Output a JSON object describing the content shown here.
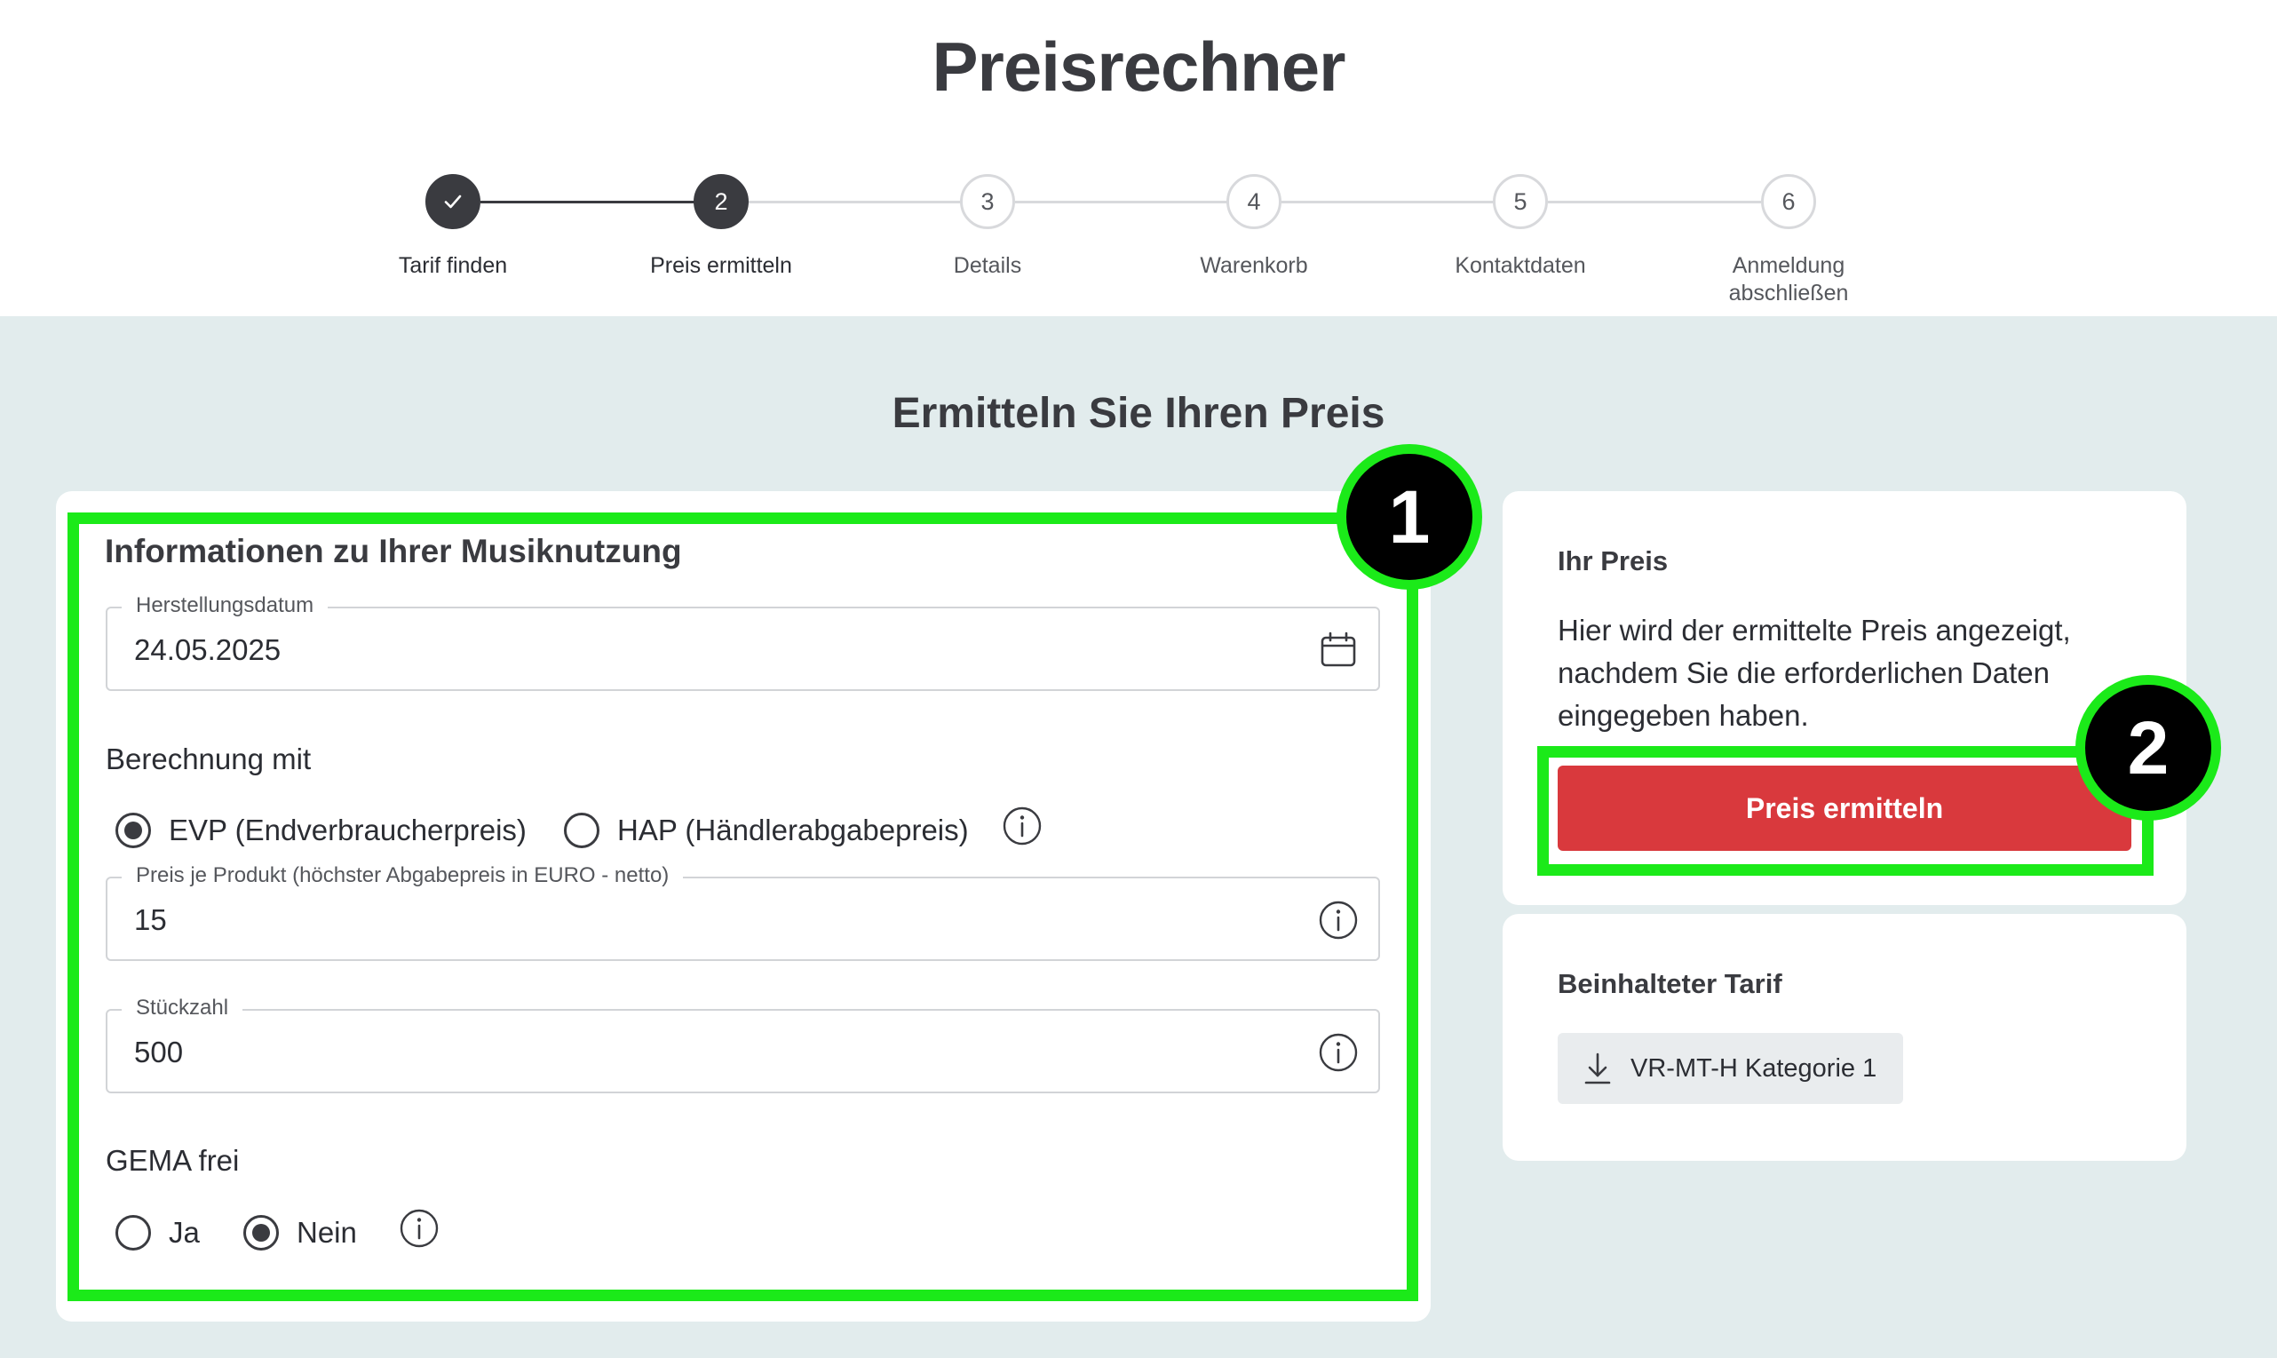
{
  "page_title": "Preisrechner",
  "stepper": {
    "steps": [
      {
        "number": "",
        "label": "Tarif finden",
        "state": "done"
      },
      {
        "number": "2",
        "label": "Preis ermitteln",
        "state": "active"
      },
      {
        "number": "3",
        "label": "Details",
        "state": "upcoming"
      },
      {
        "number": "4",
        "label": "Warenkorb",
        "state": "upcoming"
      },
      {
        "number": "5",
        "label": "Kontaktdaten",
        "state": "upcoming"
      },
      {
        "number": "6",
        "label_line1": "Anmeldung",
        "label_line2": "abschließen",
        "state": "upcoming"
      }
    ],
    "done_icon": "check-icon"
  },
  "section_title": "Ermitteln Sie Ihren Preis",
  "form": {
    "heading": "Informationen zu Ihrer Musiknutzung",
    "date_field": {
      "label": "Herstellungsdatum",
      "value": "24.05.2025",
      "icon": "calendar-icon"
    },
    "calc_group": {
      "label": "Berechnung mit",
      "options": [
        "EVP (Endverbraucherpreis)",
        "HAP (Händlerabgabepreis)"
      ],
      "selected": "EVP (Endverbraucherpreis)"
    },
    "price_field": {
      "label": "Preis je Produkt (höchster Abgabepreis in EURO - netto)",
      "value": "15",
      "icon": "info-icon"
    },
    "quantity_field": {
      "label": "Stückzahl",
      "value": "500",
      "icon": "info-icon"
    },
    "gema_group": {
      "label": "GEMA frei",
      "options": [
        "Ja",
        "Nein"
      ],
      "selected": "Nein"
    }
  },
  "price_card": {
    "title": "Ihr Preis",
    "text": "Hier wird der ermittelte Preis angezeigt, nachdem Sie die erforderlichen Daten eingegeben haben.",
    "button_label": "Preis ermitteln"
  },
  "tarif_card": {
    "title": "Beinhalteter Tarif",
    "chip_label": "VR-MT-H Kategorie 1",
    "chip_icon": "download-icon"
  },
  "annotations": {
    "badge_1": "1",
    "badge_2": "2",
    "highlight_color": "#1bea19"
  },
  "colors": {
    "accent_button": "#d9393d",
    "dark": "#3a3b40",
    "background_main": "#e2eced"
  }
}
